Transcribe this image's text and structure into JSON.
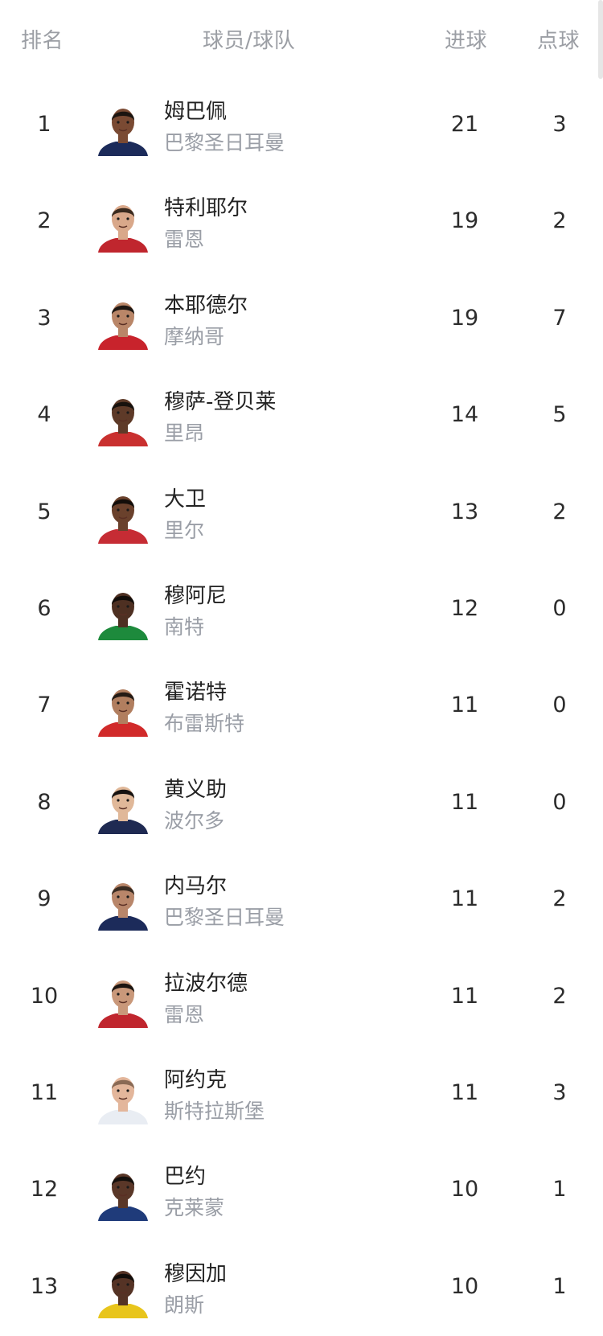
{
  "header": {
    "rank": "排名",
    "player_team": "球员/球队",
    "goals": "进球",
    "penalties": "点球"
  },
  "rows": [
    {
      "rank": "1",
      "name": "姆巴佩",
      "team": "巴黎圣日耳曼",
      "goals": "21",
      "penalties": "3",
      "skin": "#7a4a33",
      "hair": "#1b1410",
      "shirt": "#1c2b5a"
    },
    {
      "rank": "2",
      "name": "特利耶尔",
      "team": "雷恩",
      "goals": "19",
      "penalties": "2",
      "skin": "#d9a88a",
      "hair": "#3a2a1e",
      "shirt": "#c0262e"
    },
    {
      "rank": "3",
      "name": "本耶德尔",
      "team": "摩纳哥",
      "goals": "19",
      "penalties": "7",
      "skin": "#b98668",
      "hair": "#1e1712",
      "shirt": "#c8232c"
    },
    {
      "rank": "4",
      "name": "穆萨-登贝莱",
      "team": "里昂",
      "goals": "14",
      "penalties": "5",
      "skin": "#5e3a28",
      "hair": "#17110d",
      "shirt": "#c9302f"
    },
    {
      "rank": "5",
      "name": "大卫",
      "team": "里尔",
      "goals": "13",
      "penalties": "2",
      "skin": "#6a412c",
      "hair": "#130e0a",
      "shirt": "#c62c34"
    },
    {
      "rank": "6",
      "name": "穆阿尼",
      "team": "南特",
      "goals": "12",
      "penalties": "0",
      "skin": "#4e3022",
      "hair": "#110c09",
      "shirt": "#1d8a3c"
    },
    {
      "rank": "7",
      "name": "霍诺特",
      "team": "布雷斯特",
      "goals": "11",
      "penalties": "0",
      "skin": "#b17e5f",
      "hair": "#241a14",
      "shirt": "#d12a2a"
    },
    {
      "rank": "8",
      "name": "黄义助",
      "team": "波尔多",
      "goals": "11",
      "penalties": "0",
      "skin": "#e0b899",
      "hair": "#161210",
      "shirt": "#1f2a52"
    },
    {
      "rank": "9",
      "name": "内马尔",
      "team": "巴黎圣日耳曼",
      "goals": "11",
      "penalties": "2",
      "skin": "#b8866a",
      "hair": "#3a2c22",
      "shirt": "#1c2b5a"
    },
    {
      "rank": "10",
      "name": "拉波尔德",
      "team": "雷恩",
      "goals": "11",
      "penalties": "2",
      "skin": "#c9987a",
      "hair": "#1c1511",
      "shirt": "#c0262e"
    },
    {
      "rank": "11",
      "name": "阿约克",
      "team": "斯特拉斯堡",
      "goals": "11",
      "penalties": "3",
      "skin": "#e3b69b",
      "hair": "#8a6a55",
      "shirt": "#e9edf3"
    },
    {
      "rank": "12",
      "name": "巴约",
      "team": "克莱蒙",
      "goals": "10",
      "penalties": "1",
      "skin": "#5a3728",
      "hair": "#140f0c",
      "shirt": "#1f3b7a"
    },
    {
      "rank": "13",
      "name": "穆因加",
      "team": "朗斯",
      "goals": "10",
      "penalties": "1",
      "skin": "#553325",
      "hair": "#120d0a",
      "shirt": "#e8c51c"
    }
  ]
}
